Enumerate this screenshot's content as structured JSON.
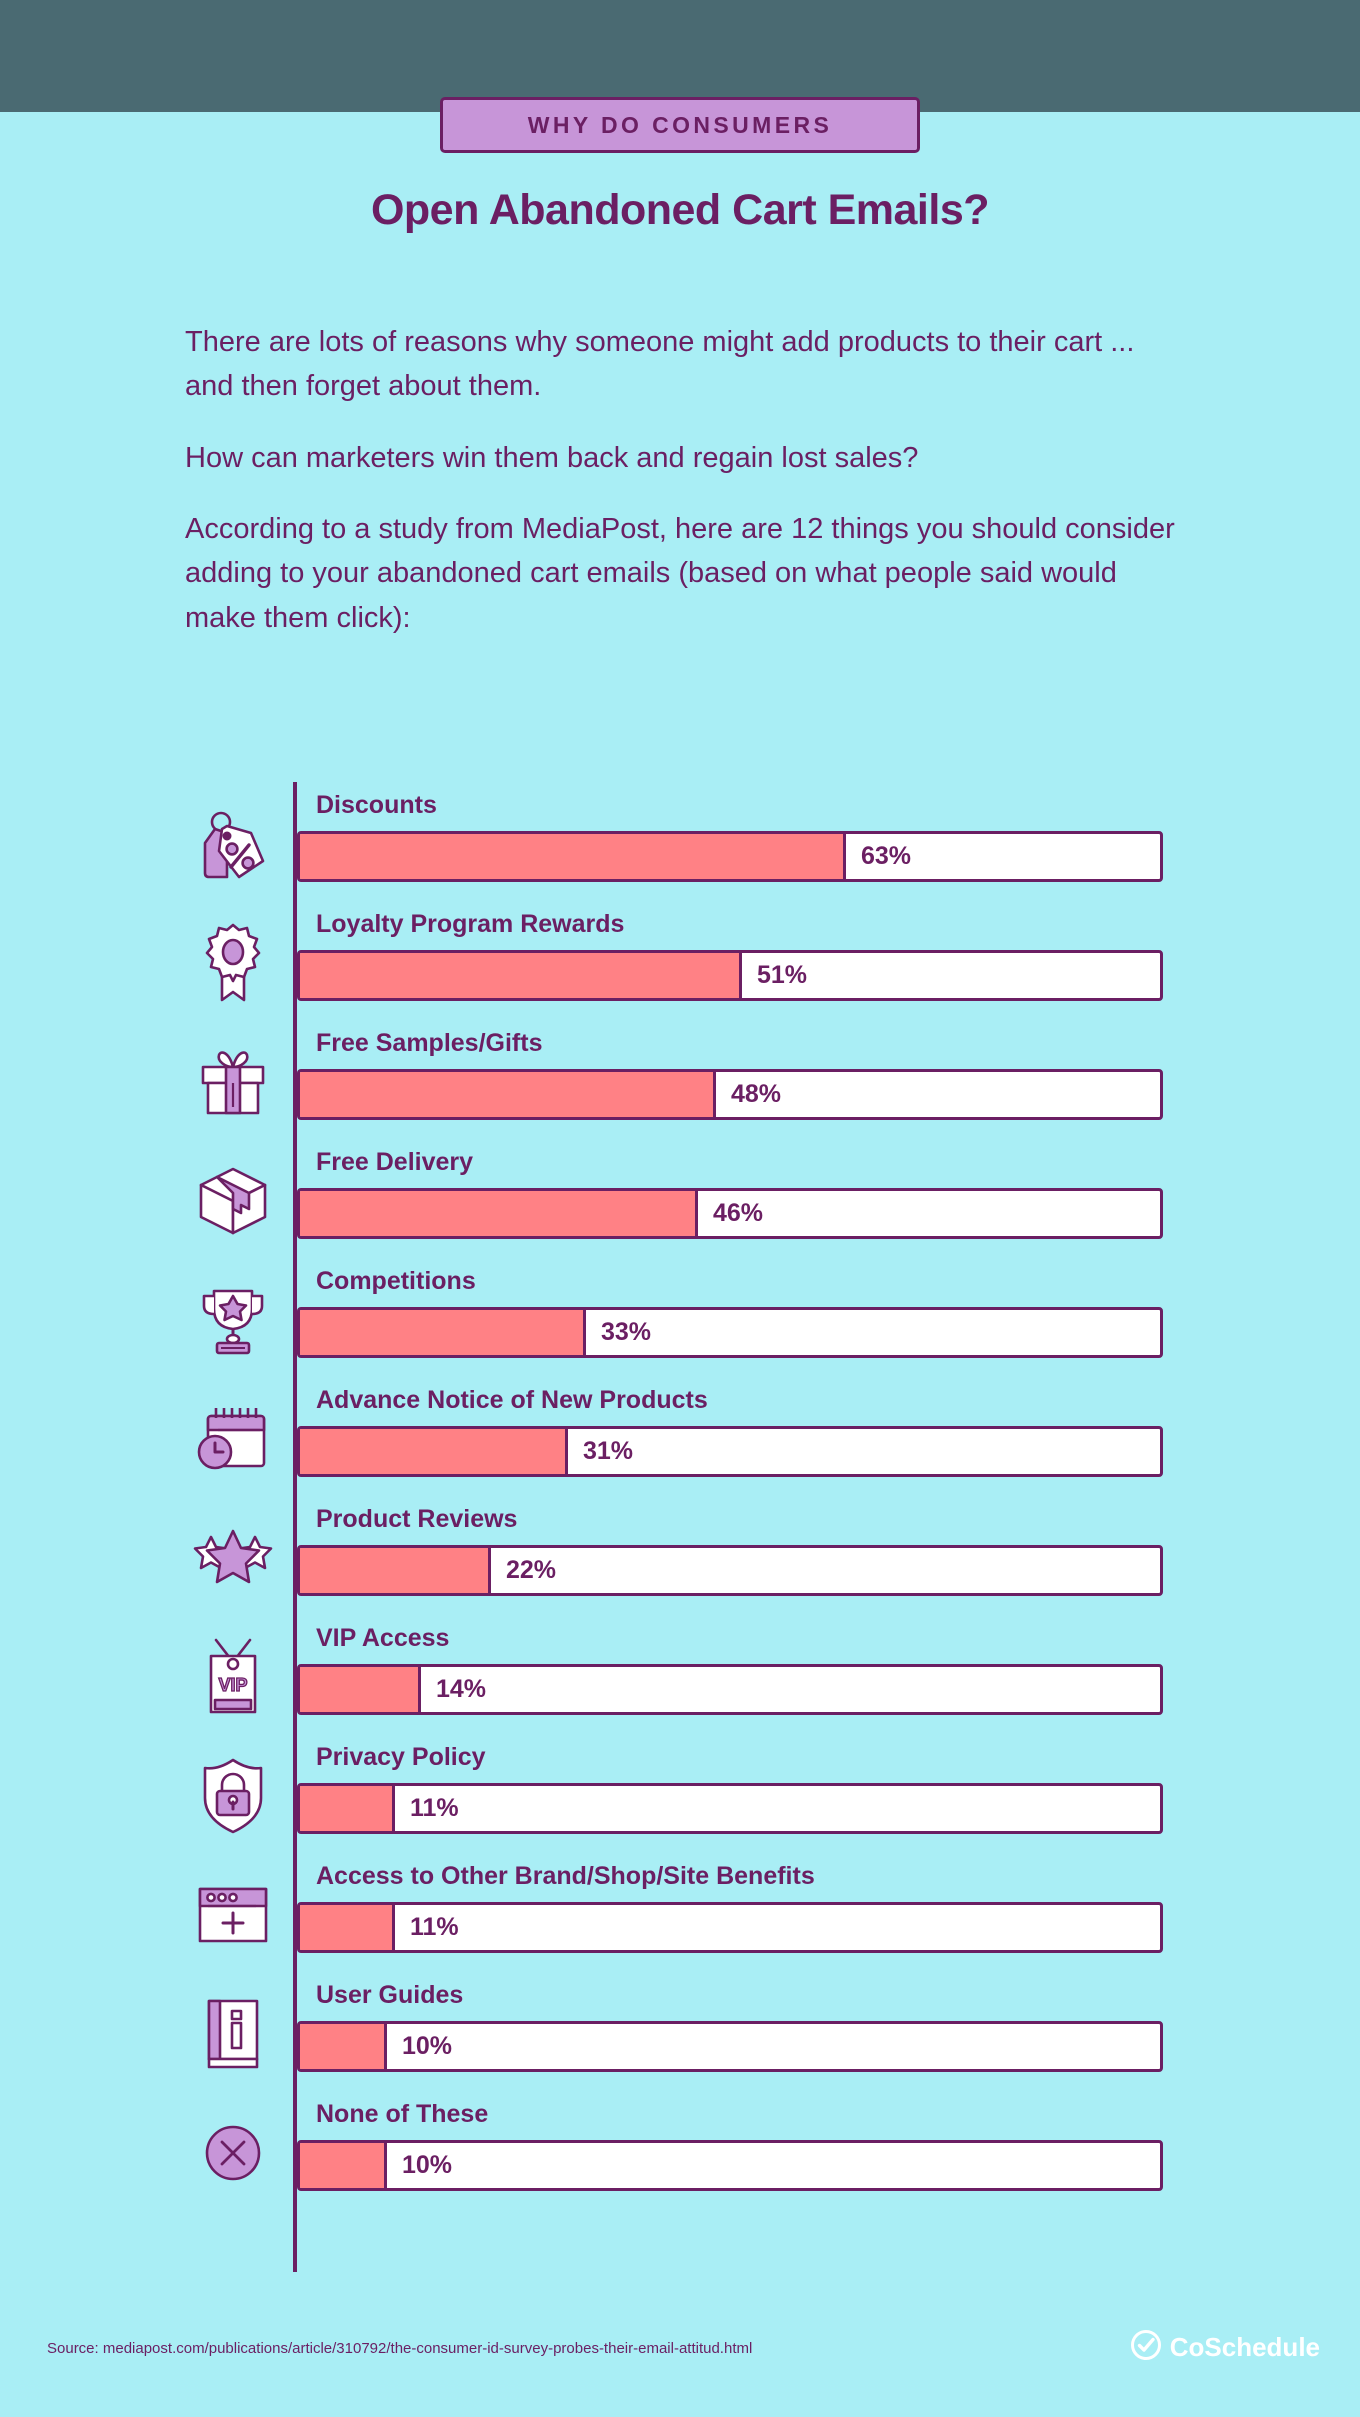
{
  "colors": {
    "background": "#A9EEF5",
    "topbar": "#4A6A72",
    "purple": "#6B1F63",
    "badge_fill": "#C795D8",
    "bar_fill": "#FF8185",
    "bar_track": "#FFFFFF",
    "icon_accent": "#C795D8"
  },
  "badge": {
    "label": "WHY DO CONSUMERS"
  },
  "headline": {
    "text": "Open Abandoned Cart Emails?"
  },
  "intro": {
    "paragraphs": [
      "There are lots of reasons why someone might add products to their cart ... and then forget about them.",
      "How can marketers win them back and regain lost sales?",
      "According to a study from MediaPost, here are 12 things you should consider adding to your abandoned cart emails (based on what people said would make them click):"
    ]
  },
  "footer": {
    "source": "Source: mediapost.com/publications/article/310792/the-consumer-id-survey-probes-their-email-attitud.html",
    "logo_text": "CoSchedule",
    "logo_icon": "coschedule-check-icon"
  },
  "chart_data": {
    "type": "bar",
    "title": "Open Abandoned Cart Emails?",
    "xlabel": "",
    "ylabel": "",
    "xlim": [
      0,
      100
    ],
    "grid": false,
    "legend": "none",
    "orientation": "horizontal",
    "value_suffix": "%",
    "categories": [
      "Discounts",
      "Loyalty Program Rewards",
      "Free Samples/Gifts",
      "Free Delivery",
      "Competitions",
      "Advance Notice of New Products",
      "Product Reviews",
      "VIP Access",
      "Privacy Policy",
      "Access to Other Brand/Shop/Site Benefits",
      "User Guides",
      "None of These"
    ],
    "values": [
      63,
      51,
      48,
      46,
      33,
      31,
      22,
      14,
      11,
      11,
      10,
      10
    ],
    "labels": [
      "63%",
      "51%",
      "48%",
      "46%",
      "33%",
      "31%",
      "22%",
      "14%",
      "11%",
      "11%",
      "10%",
      "10%"
    ],
    "icons": [
      "price-tag-percent-icon",
      "award-ribbon-icon",
      "gift-box-icon",
      "shipping-box-icon",
      "trophy-star-icon",
      "calendar-clock-icon",
      "stars-review-icon",
      "vip-tag-icon",
      "shield-lock-icon",
      "browser-plus-icon",
      "book-info-icon",
      "circle-x-icon"
    ]
  }
}
